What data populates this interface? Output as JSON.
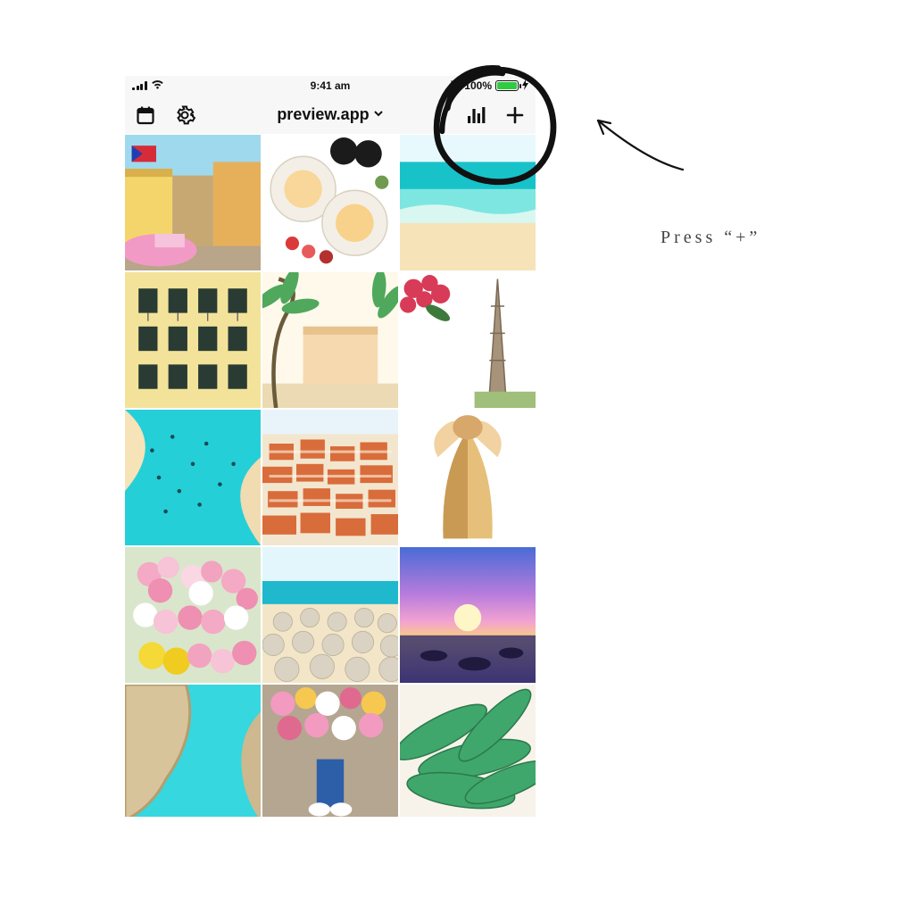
{
  "statusbar": {
    "time": "9:41 am",
    "battery_pct": "100%"
  },
  "navbar": {
    "title": "preview.app",
    "icons": {
      "calendar": "calendar-icon",
      "settings": "gear-icon",
      "analytics": "bars-icon",
      "add": "plus-icon"
    }
  },
  "grid": {
    "tiles": [
      {
        "name": "street-pink-car"
      },
      {
        "name": "breakfast-bowls"
      },
      {
        "name": "beach-waves"
      },
      {
        "name": "yellow-building"
      },
      {
        "name": "palm-facade"
      },
      {
        "name": "eiffel-flowers"
      },
      {
        "name": "beachgoers-aerial"
      },
      {
        "name": "terracotta-town"
      },
      {
        "name": "woman-hair"
      },
      {
        "name": "rose-bouquets"
      },
      {
        "name": "beach-umbrellas"
      },
      {
        "name": "sunset-boats"
      },
      {
        "name": "rocky-coast"
      },
      {
        "name": "shoes-flowers"
      },
      {
        "name": "palm-leaves"
      }
    ]
  },
  "annotation": {
    "caption": "Press “+”"
  }
}
